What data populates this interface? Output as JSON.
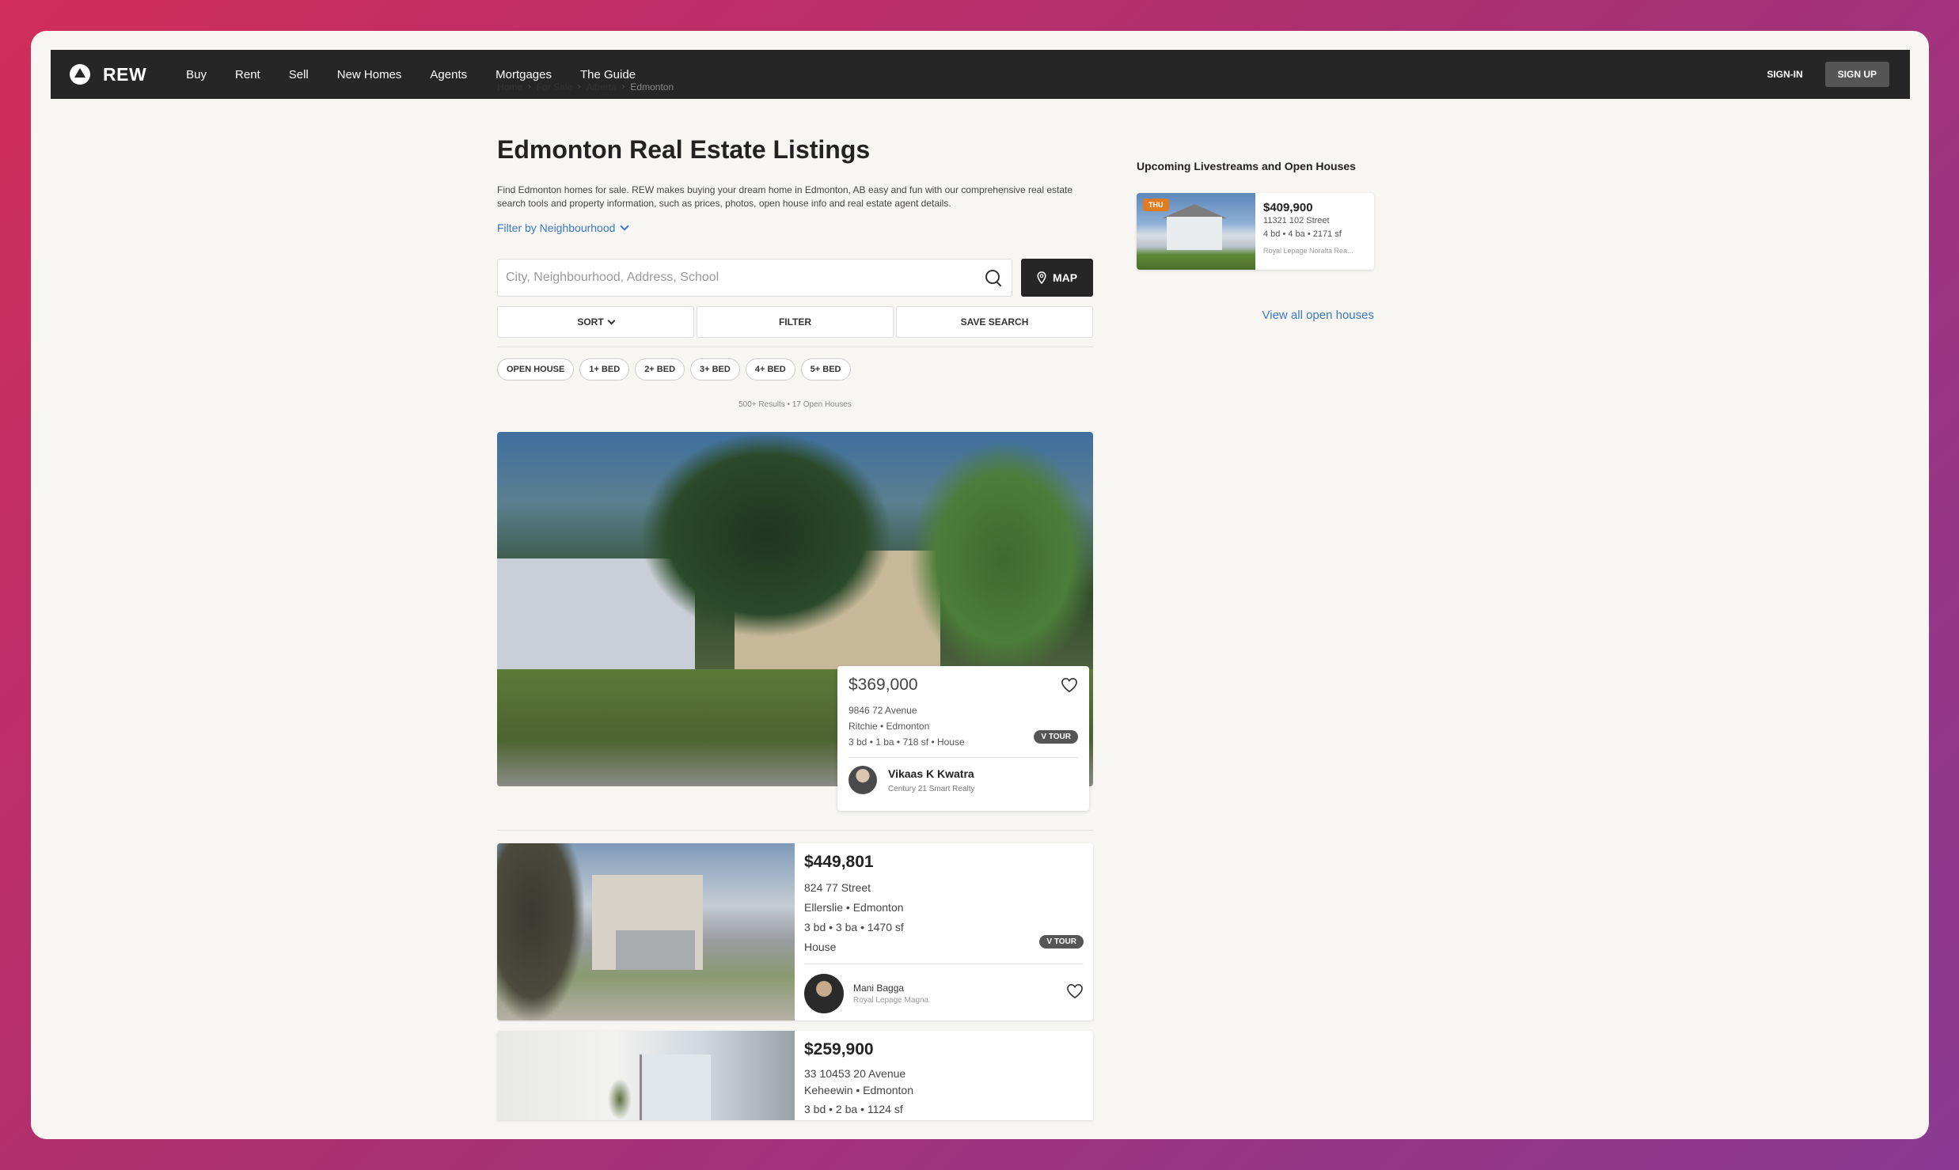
{
  "nav": {
    "logo_text": "REW",
    "links": [
      "Buy",
      "Rent",
      "Sell",
      "New Homes",
      "Agents",
      "Mortgages",
      "The Guide"
    ],
    "sign_in": "SIGN-IN",
    "sign_up": "SIGN UP"
  },
  "breadcrumb": [
    "Home",
    "For Sale",
    "Alberta",
    "Edmonton"
  ],
  "page": {
    "title": "Edmonton Real Estate Listings",
    "intro": "Find Edmonton homes for sale. REW makes buying your dream home in Edmonton, AB easy and fun with our comprehensive real estate search tools and property information, such as prices, photos, open house info and real estate agent details.",
    "filter_link": "Filter by Neighbourhood"
  },
  "search": {
    "placeholder": "City, Neighbourhood, Address, School",
    "value": "",
    "map_label": "MAP"
  },
  "controls": {
    "sort": "SORT",
    "filter": "FILTER",
    "save_search": "SAVE SEARCH"
  },
  "chips": [
    "OPEN HOUSE",
    "1+ BED",
    "2+ BED",
    "3+ BED",
    "4+ BED",
    "5+ BED"
  ],
  "results_count": "500+ Results • 17 Open Houses",
  "featured": {
    "price": "$369,000",
    "address": "9846 72 Avenue",
    "area": "Ritchie • Edmonton",
    "details": "3 bd • 1 ba • 718 sf • House",
    "vtour": "V TOUR",
    "agent_name": "Vikaas K Kwatra",
    "agent_office": "Century 21 Smart Realty"
  },
  "listings": [
    {
      "price": "$449,801",
      "address": "824 77 Street",
      "area": "Ellerslie • Edmonton",
      "details": "3 bd • 3 ba • 1470 sf",
      "type": "House",
      "vtour": "V TOUR",
      "agent_name": "Mani Bagga",
      "agent_office": "Royal Lepage Magna"
    },
    {
      "price": "$259,900",
      "address": "33 10453 20 Avenue",
      "area": "Keheewin • Edmonton",
      "details": "3 bd • 2 ba • 1124 sf"
    }
  ],
  "sidebar": {
    "title": "Upcoming Livestreams and Open Houses",
    "open_house": {
      "badge": "THU",
      "price": "$409,900",
      "address": "11321 102 Street",
      "details": "4 bd • 4 ba • 2171 sf",
      "broker": "Royal Lepage Noralta Rea..."
    },
    "view_all": "View all open houses"
  },
  "colors": {
    "nav_bg": "#262626",
    "link": "#3a78c8",
    "badge": "#e27a1f",
    "vtour": "#555555"
  }
}
